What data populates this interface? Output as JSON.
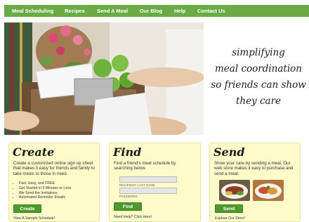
{
  "nav": {
    "items": [
      {
        "label": "Meal Scheduling"
      },
      {
        "label": "Recipes"
      },
      {
        "label": "Send A Meal"
      },
      {
        "label": "Our Blog"
      },
      {
        "label": "Help"
      },
      {
        "label": "Contact Us"
      }
    ]
  },
  "hero": {
    "tagline_lines": [
      "simplifying",
      "meal coordination",
      "so friends can show",
      "they care"
    ]
  },
  "create": {
    "title": "Create",
    "desc": "Create a customized online sign up sheet that makes it easy for friends and family to take meals to those in need.",
    "bullets": [
      "Fast, Easy, and FREE",
      "Get Started in 5 Minutes or Less",
      "We Send the Invitations",
      "Automated Reminder Emails"
    ],
    "button": "Create",
    "link": "View A Sample Schedule!"
  },
  "find": {
    "title": "Find",
    "desc": "Find a friend's meal schedule by searching below.",
    "field1_label": "RECIPIENT LAST NAME",
    "field2_label": "PASSWORD",
    "field1_value": "",
    "field2_value": "",
    "button": "Find",
    "link": "Need Help? Click Here!"
  },
  "send": {
    "title": "Send",
    "desc": "Show your care by sending a meal. Our web store makes it easy to purchase and send a meal.",
    "button": "Send",
    "link": "Explore Our Store!"
  },
  "colors": {
    "nav_green": "#6aab45",
    "button_green": "#4f9a2f",
    "card_bg": "#fdfbc9"
  }
}
